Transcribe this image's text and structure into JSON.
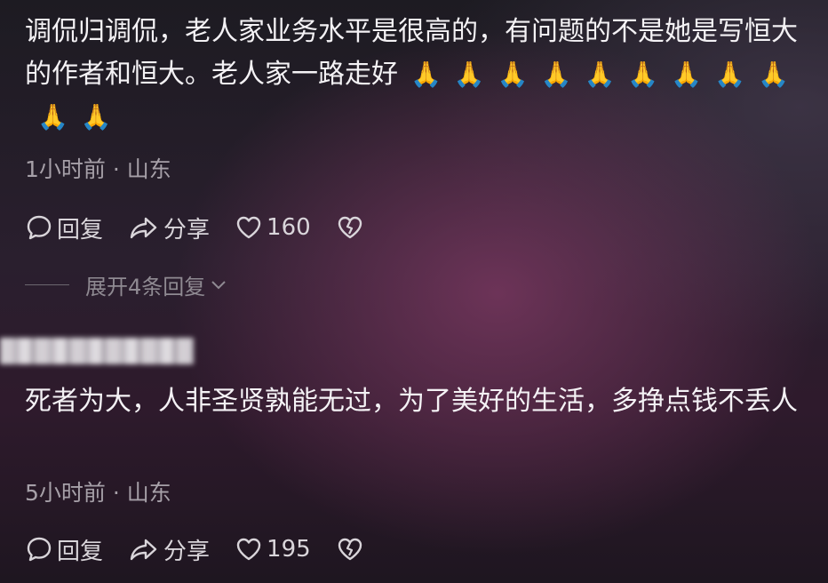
{
  "comments": [
    {
      "text": "调侃归调侃，老人家业务水平是很高的，有问题的不是她是写恒大的作者和恒大。老人家一路走好",
      "emoji": "🙏",
      "emoji_count": 11,
      "meta": "1小时前 · 山东",
      "reply_label": "回复",
      "share_label": "分享",
      "like_count": "160",
      "expand_label": "展开4条回复"
    },
    {
      "text": "死者为大，人非圣贤孰能无过，为了美好的生活，多挣点钱不丢人",
      "meta": "5小时前 · 山东",
      "reply_label": "回复",
      "share_label": "分享",
      "like_count": "195"
    }
  ],
  "colors": {
    "text": "#f4f2f5",
    "meta": "#a6a0a8",
    "action": "#d9d5da"
  }
}
